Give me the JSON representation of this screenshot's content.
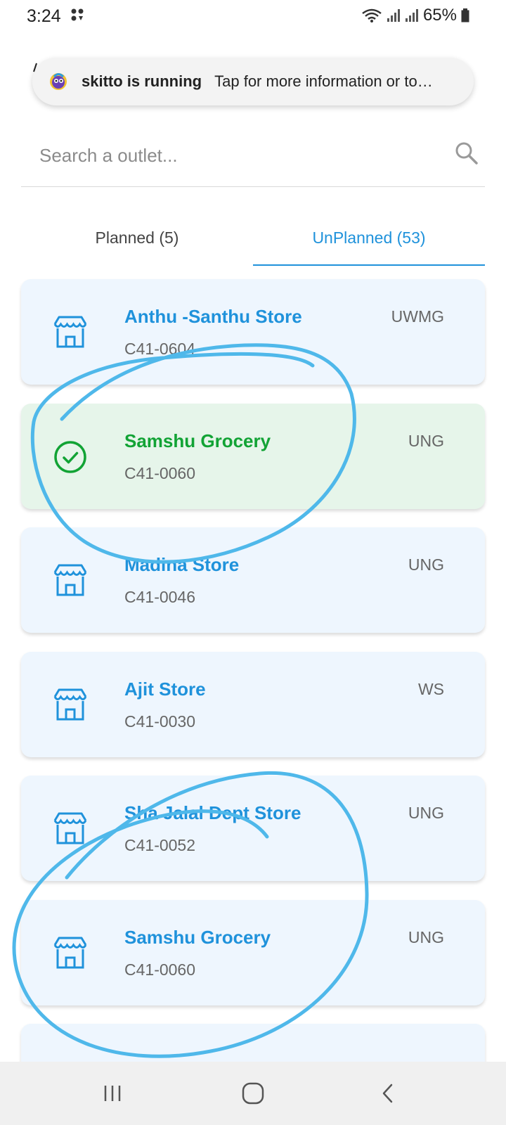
{
  "status_bar": {
    "time": "3:24",
    "battery": "65%"
  },
  "notification": {
    "app_name": "skitto is running",
    "text": "Tap for more information or to…"
  },
  "search": {
    "placeholder": "Search a outlet..."
  },
  "tabs": [
    {
      "label": "Planned (5)",
      "active": false
    },
    {
      "label": "UnPlanned (53)",
      "active": true
    }
  ],
  "outlets": [
    {
      "name": "Anthu -Santhu Store",
      "code": "C41-0604",
      "type": "UWMG",
      "icon": "store-icon",
      "visited": false
    },
    {
      "name": "Samshu Grocery",
      "code": "C41-0060",
      "type": "UNG",
      "icon": "check-circle-icon",
      "visited": true
    },
    {
      "name": "Madina Store",
      "code": "C41-0046",
      "type": "UNG",
      "icon": "store-icon",
      "visited": false
    },
    {
      "name": "Ajit Store",
      "code": "C41-0030",
      "type": "WS",
      "icon": "store-icon",
      "visited": false
    },
    {
      "name": "Sha Jalal Dept Store",
      "code": "C41-0052",
      "type": "UNG",
      "icon": "store-icon",
      "visited": false
    },
    {
      "name": "Samshu Grocery",
      "code": "C41-0060",
      "type": "UNG",
      "icon": "store-icon",
      "visited": false
    }
  ],
  "colors": {
    "accent": "#1f92db",
    "visited_green": "#12a335",
    "card_bg": "#eef6fe",
    "visited_card_bg": "#e6f5ea",
    "annotation_ink": "#4fb8ea"
  },
  "nav_bar": {
    "icons": [
      "recent-apps-icon",
      "home-icon",
      "back-icon"
    ]
  }
}
